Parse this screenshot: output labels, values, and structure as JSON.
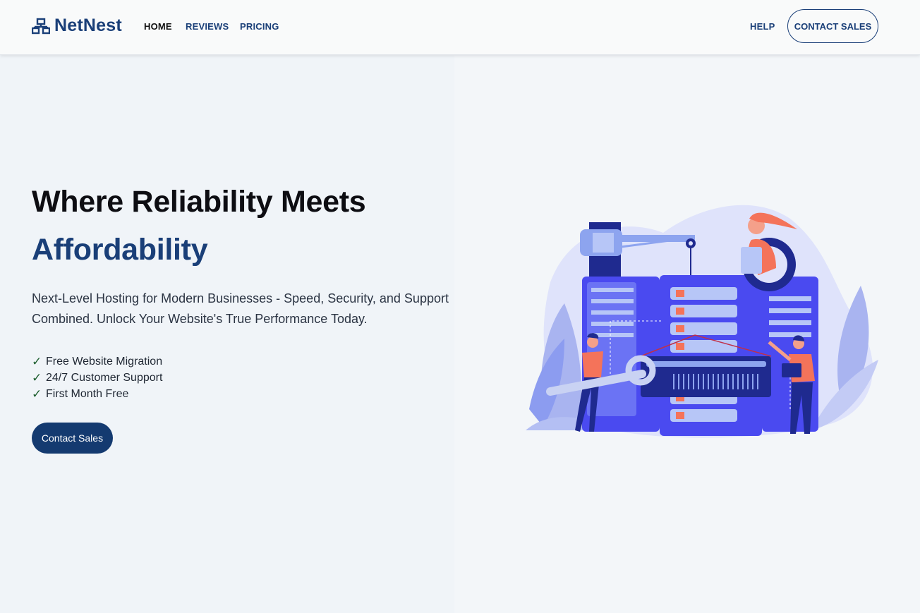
{
  "brand": {
    "name": "NetNest",
    "icon": "network-icon"
  },
  "nav": {
    "links": [
      {
        "label": "HOME",
        "active": true
      },
      {
        "label": "REVIEWS",
        "active": false
      },
      {
        "label": "PRICING",
        "active": false
      }
    ],
    "help_label": "HELP",
    "contact_label": "CONTACT SALES"
  },
  "hero": {
    "title_line1": "Where Reliability Meets",
    "title_line2": "Affordability",
    "subtitle": "Next-Level Hosting for Modern Businesses - Speed, Security, and Support Combined. Unlock Your Website's True Performance Today.",
    "features": [
      "Free Website Migration",
      "24/7 Customer Support",
      "First Month Free"
    ],
    "check_icon": "checkmark-icon",
    "cta_label": "Contact Sales"
  },
  "colors": {
    "brand": "#1a3f78",
    "button": "#143a70",
    "illustration_primary": "#4a4af0",
    "illustration_accent": "#f4735a"
  }
}
